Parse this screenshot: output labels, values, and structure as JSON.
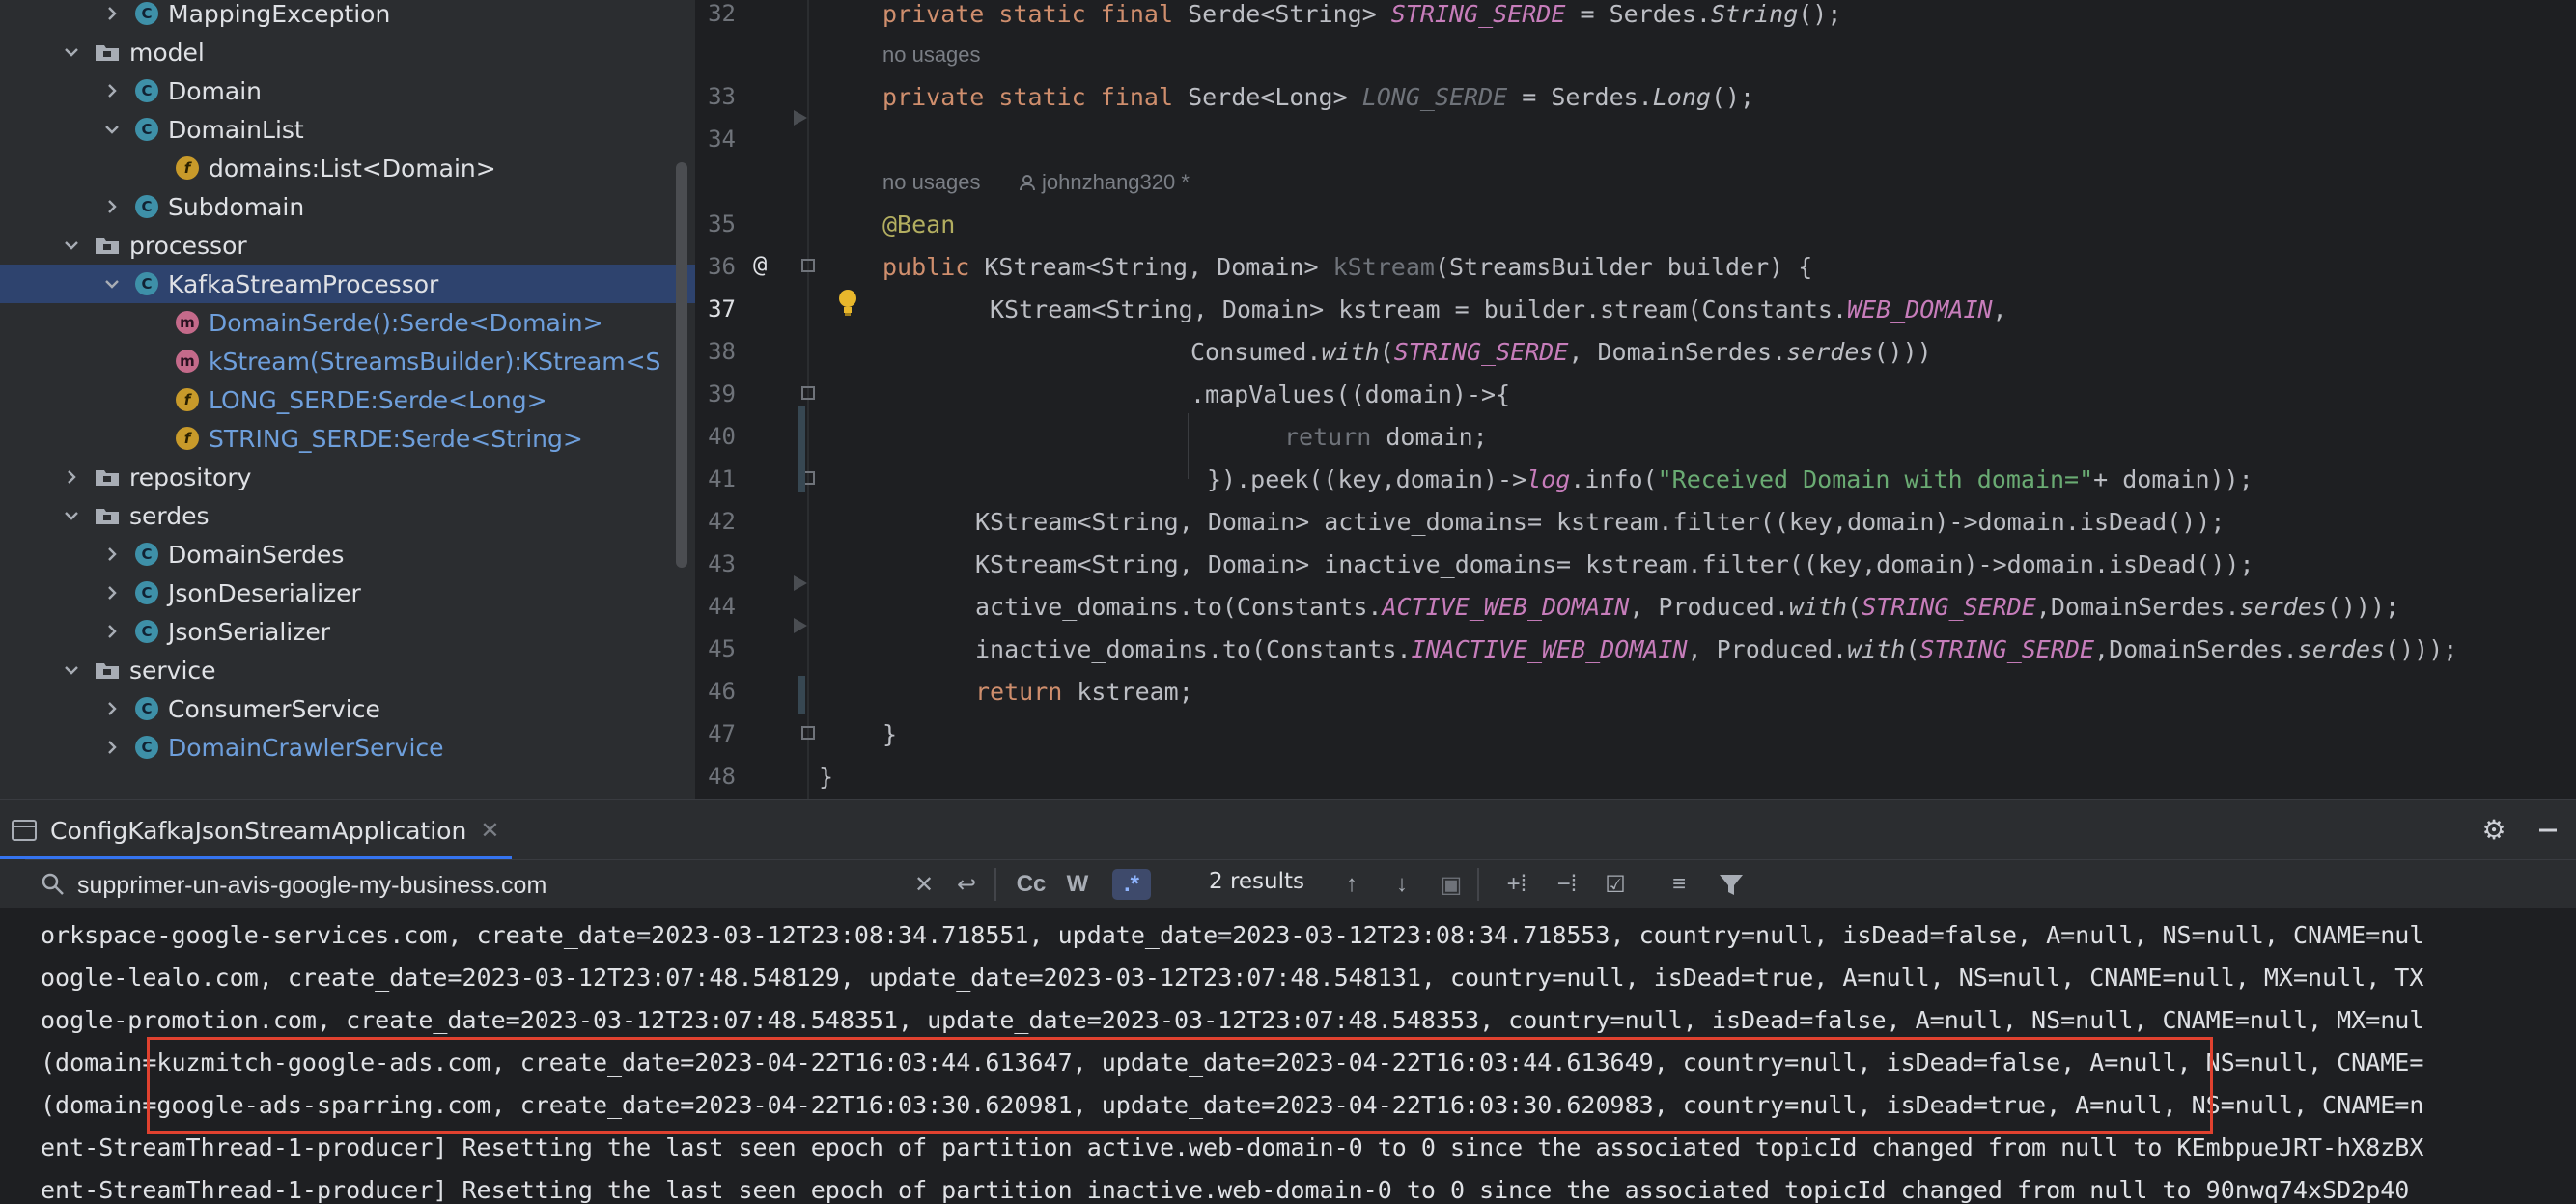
{
  "tree": {
    "items": [
      {
        "label": "MappingException",
        "kind": "class",
        "expanded": false
      },
      {
        "label": "model",
        "kind": "folder",
        "expanded": true
      },
      {
        "label": "Domain",
        "kind": "class",
        "expanded": false
      },
      {
        "label": "DomainList",
        "kind": "class",
        "expanded": true
      },
      {
        "label": "domains:List<Domain>",
        "kind": "field"
      },
      {
        "label": "Subdomain",
        "kind": "class",
        "expanded": false
      },
      {
        "label": "processor",
        "kind": "folder",
        "expanded": true
      },
      {
        "label": "KafkaStreamProcessor",
        "kind": "class",
        "expanded": true,
        "selected": true
      },
      {
        "label": "DomainSerde():Serde<Domain>",
        "kind": "method"
      },
      {
        "label": "kStream(StreamsBuilder):KStream<S",
        "kind": "method"
      },
      {
        "label": "LONG_SERDE:Serde<Long>",
        "kind": "field"
      },
      {
        "label": "STRING_SERDE:Serde<String>",
        "kind": "field"
      },
      {
        "label": "repository",
        "kind": "folder",
        "expanded": false
      },
      {
        "label": "serdes",
        "kind": "folder",
        "expanded": true
      },
      {
        "label": "DomainSerdes",
        "kind": "class",
        "expanded": false
      },
      {
        "label": "JsonDeserializer",
        "kind": "class",
        "expanded": false
      },
      {
        "label": "JsonSerializer",
        "kind": "class",
        "expanded": false
      },
      {
        "label": "service",
        "kind": "folder",
        "expanded": true
      },
      {
        "label": "ConsumerService",
        "kind": "class",
        "expanded": false
      },
      {
        "label": "DomainCrawlerService",
        "kind": "class",
        "expanded": false
      }
    ]
  },
  "editor": {
    "line_numbers": [
      "32",
      "33",
      "34",
      "35",
      "36",
      "37",
      "38",
      "39",
      "40",
      "41",
      "42",
      "43",
      "44",
      "45",
      "46",
      "47",
      "48"
    ],
    "hints": {
      "no_usages_1": "no usages",
      "no_usages_2": "no usages",
      "author": "johnzhang320 *"
    },
    "gutter_at": "@",
    "code": {
      "l32_a": "private static final ",
      "l32_b": "Serde<String> ",
      "l32_c": "STRING_SERDE",
      "l32_d": " = Serdes.",
      "l32_e": "String",
      "l32_f": "();",
      "l33_a": "private static final ",
      "l33_b": "Serde<Long> ",
      "l33_c": "LONG_SERDE",
      "l33_d": " = Serdes.",
      "l33_e": "Long",
      "l33_f": "();",
      "l35": "@Bean",
      "l36_a": "public ",
      "l36_b": "KStream<String, Domain> ",
      "l36_c": "kStream",
      "l36_d": "(StreamsBuilder builder) {",
      "l37_a": "KStream<String, Domain> kstream = builder.stream(Constants.",
      "l37_b": "WEB_DOMAIN",
      "l37_c": ",",
      "l38_a": "Consumed.",
      "l38_b": "with",
      "l38_c": "(",
      "l38_d": "STRING_SERDE",
      "l38_e": ", DomainSerdes.",
      "l38_f": "serdes",
      "l38_g": "()))",
      "l39": ".mapValues((domain)->{",
      "l40_a": "return",
      "l40_b": " domain;",
      "l41_a": "}).peek((key,domain)->",
      "l41_b": "log",
      "l41_c": ".info(",
      "l41_d": "\"Received Domain with domain=\"",
      "l41_e": "+ domain));",
      "l42": "KStream<String, Domain> active_domains= kstream.filter((key,domain)->domain.isDead());",
      "l43": "KStream<String, Domain> inactive_domains= kstream.filter((key,domain)->domain.isDead());",
      "l44_a": "active_domains.to(Constants.",
      "l44_b": "ACTIVE_WEB_DOMAIN",
      "l44_c": ", Produced.",
      "l44_d": "with",
      "l44_e": "(",
      "l44_f": "STRING_SERDE",
      "l44_g": ",DomainSerdes.",
      "l44_h": "serdes",
      "l44_i": "()));",
      "l45_a": "inactive_domains.to(Constants.",
      "l45_b": "INACTIVE_WEB_DOMAIN",
      "l45_c": ", Produced.",
      "l45_d": "with",
      "l45_e": "(",
      "l45_f": "STRING_SERDE",
      "l45_g": ",DomainSerdes.",
      "l45_h": "serdes",
      "l45_i": "()));",
      "l46_a": "return",
      "l46_b": " kstream;",
      "l47": "}",
      "l48": "}"
    }
  },
  "run": {
    "tab_label": "ConfigKafkaJsonStreamApplication",
    "search_value": "supprimer-un-avis-google-my-business.com",
    "results": "2 results",
    "toggles": {
      "case": "Cc",
      "words": "W",
      "regex": ".*"
    },
    "console_lines": [
      "orkspace-google-services.com, create_date=2023-03-12T23:08:34.718551, update_date=2023-03-12T23:08:34.718553, country=null, isDead=false, A=null, NS=null, CNAME=nul",
      "oogle-lealo.com, create_date=2023-03-12T23:07:48.548129, update_date=2023-03-12T23:07:48.548131, country=null, isDead=true, A=null, NS=null, CNAME=null, MX=null, TX",
      "oogle-promotion.com, create_date=2023-03-12T23:07:48.548351, update_date=2023-03-12T23:07:48.548353, country=null, isDead=false, A=null, NS=null, CNAME=null, MX=nul",
      "(domain=kuzmitch-google-ads.com, create_date=2023-04-22T16:03:44.613647, update_date=2023-04-22T16:03:44.613649, country=null, isDead=false, A=null, NS=null, CNAME=",
      "(domain=google-ads-sparring.com, create_date=2023-04-22T16:03:30.620981, update_date=2023-04-22T16:03:30.620983, country=null, isDead=true, A=null, NS=null, CNAME=n",
      "ent-StreamThread-1-producer] Resetting the last seen epoch of partition active.web-domain-0 to 0 since the associated topicId changed from null to KEmbpueJRT-hX8zBX",
      "ent-StreamThread-1-producer] Resetting the last seen epoch of partition inactive.web-domain-0 to 0 since the associated topicId changed from null to 90nwq74xSD2p40"
    ]
  }
}
